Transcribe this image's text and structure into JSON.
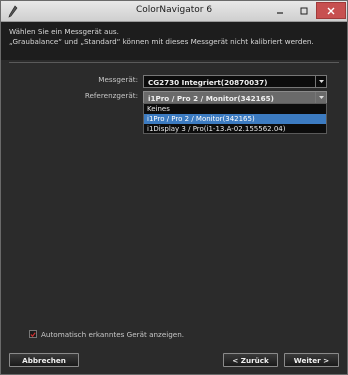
{
  "window": {
    "title": "ColorNavigator 6"
  },
  "header": {
    "line1": "Wählen Sie ein Messgerät aus.",
    "line2": "„Graubalance“ und „Standard“ können mit dieses Messgerät nicht kalibriert werden."
  },
  "form": {
    "device_label": "Messgerät:",
    "device_value": "CG2730 Integriert(20870037)",
    "reference_label": "Referenzgerät:",
    "reference_value": "i1Pro / Pro 2 / Monitor(342165)",
    "reference_options": [
      "Keines",
      "i1Pro / Pro 2 / Monitor(342165)",
      "i1Display 3 / Pro(i1-13.A-02.155562.04)"
    ],
    "reference_selected_index": 1
  },
  "options": {
    "auto_detect_label": "Automatisch erkanntes Gerät anzeigen.",
    "auto_detect_checked": true
  },
  "buttons": {
    "cancel": "Abbrechen",
    "back": "< Zurück",
    "next": "Weiter >"
  },
  "colors": {
    "selection": "#3c7bc1",
    "close_button": "#c75050",
    "checkbox_mark": "#d03030"
  }
}
